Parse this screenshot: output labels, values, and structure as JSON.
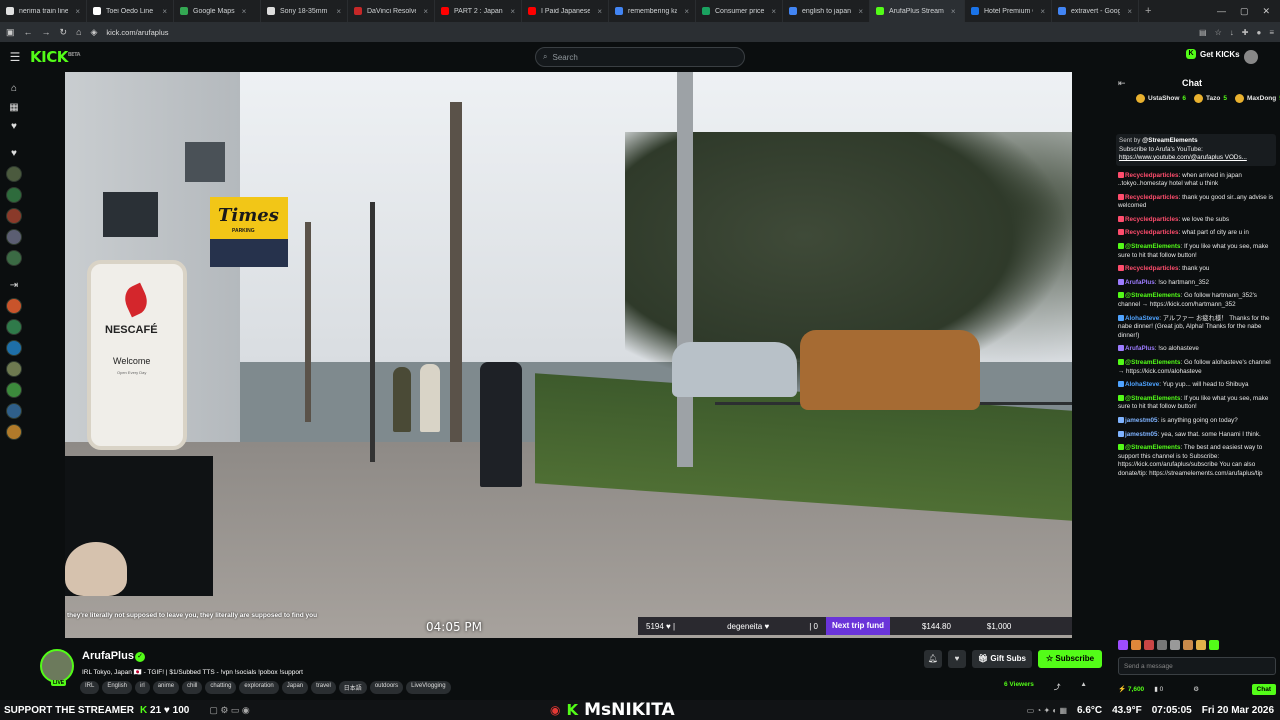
{
  "browser": {
    "tabs": [
      {
        "label": "nerima train line map",
        "color": "#e0e0e0"
      },
      {
        "label": "Toei Ōedo Line - Wiki",
        "color": "#ffffff"
      },
      {
        "label": "Google Maps",
        "color": "#34a853"
      },
      {
        "label": "Sony 18-35mm GM L",
        "color": "#dddddd"
      },
      {
        "label": "DaVinci Resolve — M",
        "color": "#c62828"
      },
      {
        "label": "PART 2 : Japan is curr",
        "color": "#ff0000"
      },
      {
        "label": "I Paid Japanese Peopl",
        "color": "#ff0000"
      },
      {
        "label": "remembering kanji - C",
        "color": "#4285f4"
      },
      {
        "label": "Consumer price inflat",
        "color": "#1aa260"
      },
      {
        "label": "english to japanese -",
        "color": "#4285f4"
      },
      {
        "label": "ArufaPlus Stream",
        "color": "#53fc18",
        "active": true
      },
      {
        "label": "Hotel Premium Green",
        "color": "#1a73e8"
      },
      {
        "label": "extravert - Google Se",
        "color": "#4285f4"
      }
    ],
    "url": "kick.com/arufaplus"
  },
  "header": {
    "logo": "KICK",
    "logo_badge": "BETA",
    "search_placeholder": "Search",
    "get_kicks": "Get KICKs"
  },
  "video": {
    "sign_times": "Times",
    "sign_parking": "PARKING",
    "nescafe": "NESCAFÉ",
    "nescafe_welcome": "Welcome",
    "nescafe_sub": "Open Every Day",
    "caption": "they're literally not supposed to leave you, they literally are supposed to find you",
    "timestamp": "04:05 PM",
    "overlay": {
      "count": "5194",
      "user": "degeneita",
      "zero": "0",
      "fund_label": "Next trip fund",
      "fund_current": "$144.80",
      "fund_goal": "$1,000"
    }
  },
  "chat": {
    "title": "Chat",
    "leaders": [
      {
        "name": "UstaShow",
        "count": "6"
      },
      {
        "name": "Tazo",
        "count": "5"
      },
      {
        "name": "MaxDong",
        "count": "5"
      }
    ],
    "pinned": {
      "sent_by": "Sent by",
      "user": "@StreamElements",
      "text": "Subscribe to Arufa's YouTube:",
      "link": "https://www.youtube.com/@arufaplus VODs..."
    },
    "messages": [
      {
        "user": "Recycledparticles",
        "color": "#ff4d6d",
        "text": "when arrived in japan ..tokyo..homestay hotel what u think"
      },
      {
        "user": "Recycledparticles",
        "color": "#ff4d6d",
        "text": "thank you good sir..any advise is welcomed"
      },
      {
        "user": "Recycledparticles",
        "color": "#ff4d6d",
        "text": "we love the subs"
      },
      {
        "user": "Recycledparticles",
        "color": "#ff4d6d",
        "text": "what part of city are u in"
      },
      {
        "user": "@StreamElements",
        "color": "#53fc18",
        "text": "If you like what you see, make sure to hit that follow button!"
      },
      {
        "user": "Recycledparticles",
        "color": "#ff4d6d",
        "text": "thank you"
      },
      {
        "user": "ArufaPlus",
        "color": "#9d7cff",
        "text": "!so hartmann_352"
      },
      {
        "user": "@StreamElements",
        "color": "#53fc18",
        "text": "Go follow hartmann_352's channel → https://kick.com/hartmann_352"
      },
      {
        "user": "AlohaSteve",
        "color": "#4fa3ff",
        "text": "アルファー お疲れ様！ Thanks for the nabe dinner! (Great job, Alpha! Thanks for the nabe dinner!)"
      },
      {
        "user": "ArufaPlus",
        "color": "#9d7cff",
        "text": "!so alohasteve"
      },
      {
        "user": "@StreamElements",
        "color": "#53fc18",
        "text": "Go follow alohasteve's channel → https://kick.com/alohasteve"
      },
      {
        "user": "AlohaSteve",
        "color": "#4fa3ff",
        "text": "Yup yup... will head to Shibuya"
      },
      {
        "user": "@StreamElements",
        "color": "#53fc18",
        "text": "If you like what you see, make sure to hit that follow button!"
      },
      {
        "user": "jamestm05",
        "color": "#7fb3ff",
        "text": "is anything going on today?"
      },
      {
        "user": "jamestm05",
        "color": "#7fb3ff",
        "text": "yea, saw that. some Hanami I think."
      },
      {
        "user": "@StreamElements",
        "color": "#53fc18",
        "text": "The best and easiest way to support this channel is to Subscribe: https://kick.com/arufaplus/subscribe You can also donate/tip: https://streamelements.com/arufaplus/tip"
      }
    ],
    "input_placeholder": "Send a message",
    "kicks_count": "7,600",
    "zero_count": "0",
    "send_label": "Chat"
  },
  "stream": {
    "name": "ArufaPlus",
    "live_label": "LIVE",
    "title": "IRL Tokyo, Japan 🇯🇵 - TGIF! | $1/Subbed TTS - !vpn !socials !pobox !support",
    "tags": [
      "IRL",
      "English",
      "irl",
      "anime",
      "chill",
      "chatting",
      "exploration",
      "Japan",
      "travel",
      "日本語",
      "outdoors",
      "LiveVlogging"
    ],
    "gift_label": "Gift Subs",
    "subscribe_label": "Subscribe",
    "viewers": "6 Viewers"
  },
  "taskbar": {
    "support": "SUPPORT THE STREAMER",
    "count_a": "21",
    "count_b": "100",
    "center_name": "MsNIKITA",
    "weather": "6.6°C",
    "humidity": "43.9°F",
    "time": "07:05:05",
    "date": "Fri 20 Mar 2026"
  }
}
